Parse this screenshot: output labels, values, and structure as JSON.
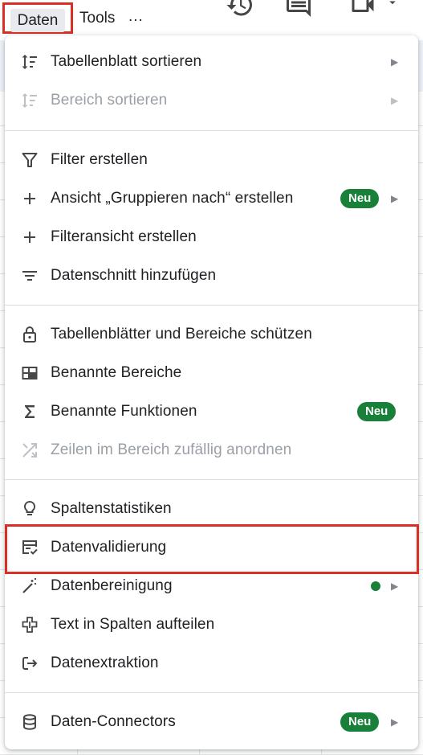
{
  "menubar": {
    "daten": "Daten",
    "tools": "Tools",
    "more": "..."
  },
  "icons": {
    "history": "history-icon",
    "comments": "comment-icon",
    "meet": "video-icon"
  },
  "menu": {
    "items": [
      {
        "label": "Tabellenblatt sortieren",
        "icon": "sort-icon",
        "submenu": true,
        "disabled": false
      },
      {
        "label": "Bereich sortieren",
        "icon": "sort-icon",
        "submenu": true,
        "disabled": true
      },
      {
        "label": "Filter erstellen",
        "icon": "filter-icon",
        "submenu": false,
        "disabled": false
      },
      {
        "label": "Ansicht „Gruppieren nach“ erstellen",
        "icon": "plus-icon",
        "submenu": true,
        "badge": "Neu",
        "disabled": false
      },
      {
        "label": "Filteransicht erstellen",
        "icon": "plus-icon",
        "submenu": false,
        "disabled": false
      },
      {
        "label": "Datenschnitt hinzufügen",
        "icon": "slicer-icon",
        "submenu": false,
        "disabled": false
      },
      {
        "label": "Tabellenblätter und Bereiche schützen",
        "icon": "lock-icon",
        "submenu": false,
        "disabled": false
      },
      {
        "label": "Benannte Bereiche",
        "icon": "named-ranges-icon",
        "submenu": false,
        "disabled": false
      },
      {
        "label": "Benannte Funktionen",
        "icon": "sigma-icon",
        "submenu": false,
        "badge": "Neu",
        "disabled": false
      },
      {
        "label": "Zeilen im Bereich zufällig anordnen",
        "icon": "shuffle-icon",
        "submenu": false,
        "disabled": true
      },
      {
        "label": "Spaltenstatistiken",
        "icon": "lightbulb-icon",
        "submenu": false,
        "disabled": false
      },
      {
        "label": "Datenvalidierung",
        "icon": "data-validation-icon",
        "submenu": false,
        "disabled": false,
        "highlighted": true
      },
      {
        "label": "Datenbereinigung",
        "icon": "magic-wand-icon",
        "submenu": true,
        "dot": true,
        "disabled": false
      },
      {
        "label": "Text in Spalten aufteilen",
        "icon": "split-columns-icon",
        "submenu": false,
        "disabled": false
      },
      {
        "label": "Datenextraktion",
        "icon": "extract-icon",
        "submenu": false,
        "disabled": false
      },
      {
        "label": "Daten-Connectors",
        "icon": "database-icon",
        "submenu": true,
        "badge": "Neu",
        "disabled": false
      }
    ]
  },
  "colors": {
    "badge": "#188038",
    "highlight": "#d93025",
    "disabled": "#9aa0a6"
  }
}
